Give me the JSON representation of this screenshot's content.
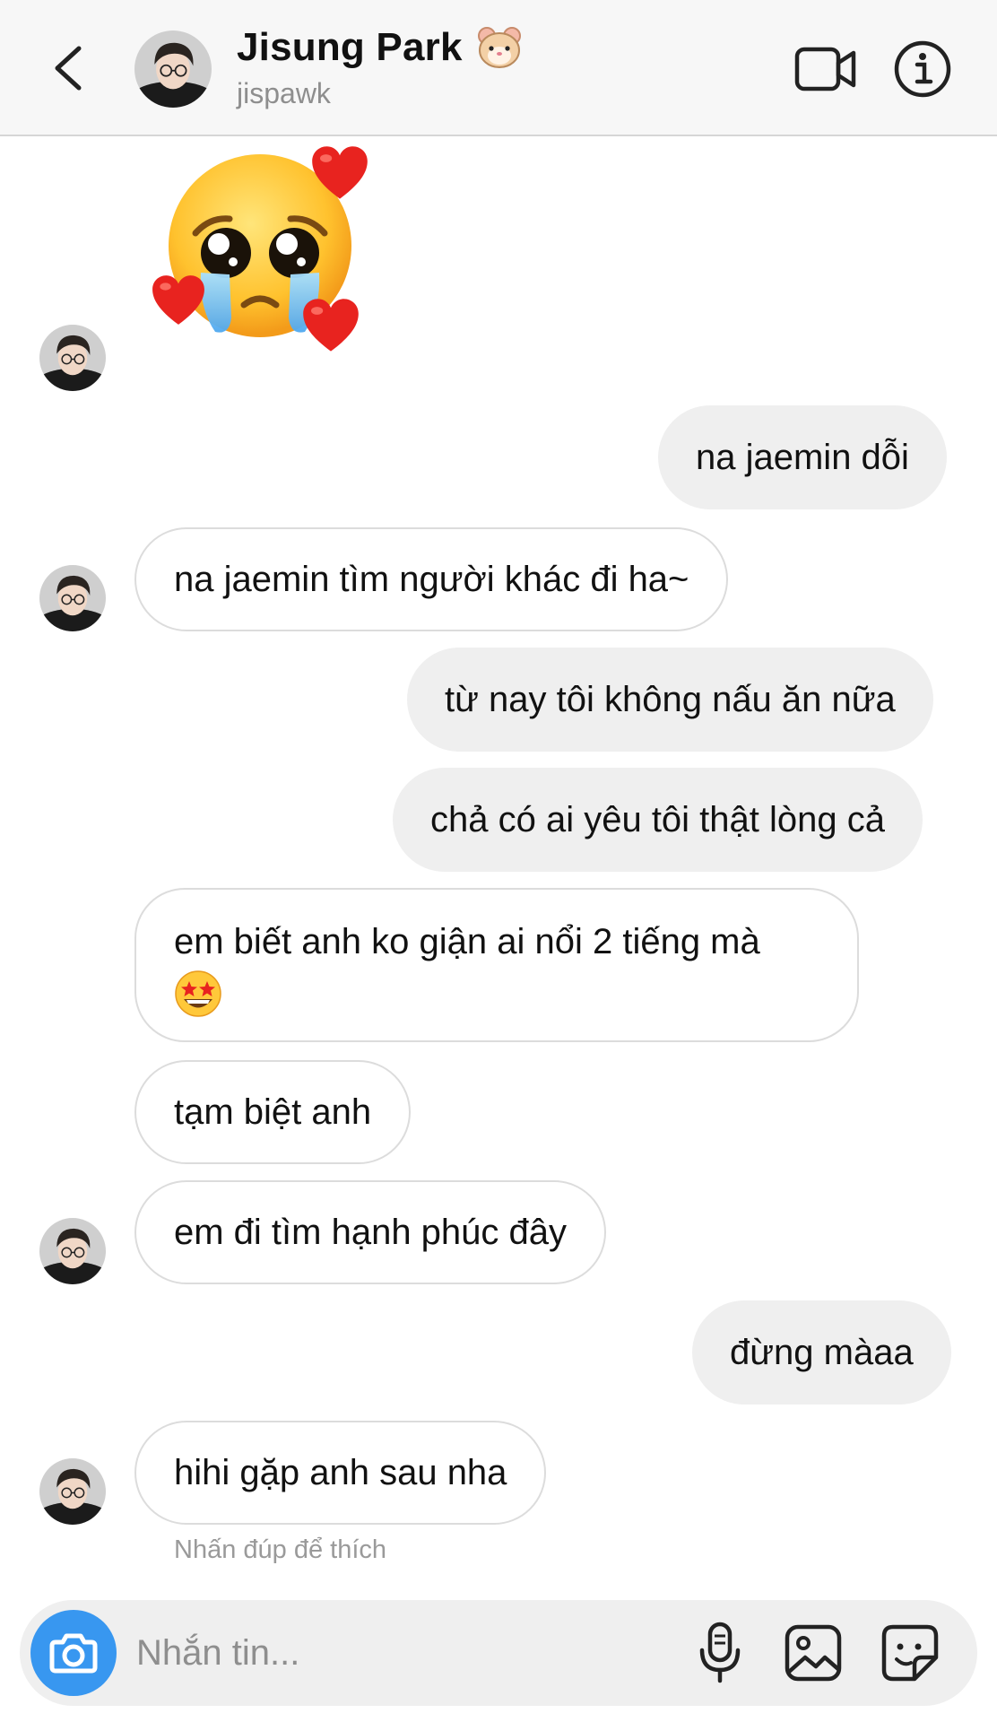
{
  "header": {
    "title": "Jisung Park",
    "title_emoji_icon": "hamster-icon",
    "username": "jispawk",
    "back_icon": "chevron-left-icon",
    "video_icon": "video-camera-icon",
    "info_icon": "info-icon"
  },
  "messages": [
    {
      "side": "in",
      "type": "sticker",
      "icon": "pleading-face-hearts-emoji"
    },
    {
      "side": "out",
      "text": "na jaemin dỗi"
    },
    {
      "side": "in",
      "text": "na jaemin tìm người khác đi ha~"
    },
    {
      "side": "out",
      "text": "từ nay tôi không nấu ăn nữa"
    },
    {
      "side": "out",
      "text": "chả có ai yêu tôi thật lòng cả"
    },
    {
      "side": "in",
      "text": "em biết anh ko giận ai nổi 2 tiếng mà",
      "emoji_icon": "star-struck-emoji"
    },
    {
      "side": "in",
      "text": "tạm biệt anh"
    },
    {
      "side": "in",
      "text": "em đi tìm hạnh phúc đây"
    },
    {
      "side": "out",
      "text": "đừng màaa"
    },
    {
      "side": "in",
      "text": "hihi gặp anh sau nha"
    }
  ],
  "hint": "Nhấn đúp để thích",
  "compose": {
    "placeholder": "Nhắn tin...",
    "camera_icon": "camera-icon",
    "mic_icon": "microphone-icon",
    "gallery_icon": "image-icon",
    "sticker_icon": "sticker-icon"
  },
  "colors": {
    "accent": "#3897f0",
    "outgoing_bubble": "#efefef",
    "incoming_border": "#dcdcdc",
    "header_bg": "#f7f7f7"
  }
}
